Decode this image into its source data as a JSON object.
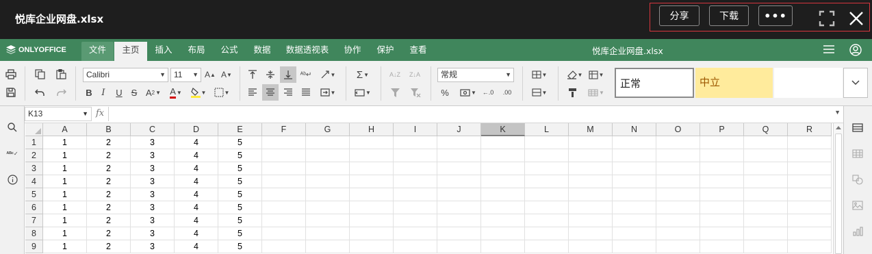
{
  "header": {
    "title": "悦库企业网盘.xlsx",
    "share_label": "分享",
    "download_label": "下载",
    "more_label": "•••"
  },
  "menubar": {
    "logo_text": "ONLYOFFICE",
    "tabs": [
      "文件",
      "主页",
      "插入",
      "布局",
      "公式",
      "数据",
      "数据透视表",
      "协作",
      "保护",
      "查看"
    ],
    "active_tab": "主页",
    "file_title": "悦库企业网盘.xlsx"
  },
  "toolbar": {
    "font_name": "Calibri",
    "font_size": "11",
    "number_format": "常规",
    "cell_styles": [
      "正常",
      "中立",
      ""
    ]
  },
  "formula_bar": {
    "name_box": "K13",
    "fx_label": "fx",
    "formula": ""
  },
  "sheet": {
    "columns": [
      "A",
      "B",
      "C",
      "D",
      "E",
      "F",
      "G",
      "H",
      "I",
      "J",
      "K",
      "L",
      "M",
      "N",
      "O",
      "P",
      "Q",
      "R"
    ],
    "active_column": "K",
    "rows": [
      {
        "num": "1",
        "cells": [
          "1",
          "2",
          "3",
          "4",
          "5"
        ]
      },
      {
        "num": "2",
        "cells": [
          "1",
          "2",
          "3",
          "4",
          "5"
        ]
      },
      {
        "num": "3",
        "cells": [
          "1",
          "2",
          "3",
          "4",
          "5"
        ]
      },
      {
        "num": "4",
        "cells": [
          "1",
          "2",
          "3",
          "4",
          "5"
        ]
      },
      {
        "num": "5",
        "cells": [
          "1",
          "2",
          "3",
          "4",
          "5"
        ]
      },
      {
        "num": "6",
        "cells": [
          "1",
          "2",
          "3",
          "4",
          "5"
        ]
      },
      {
        "num": "7",
        "cells": [
          "1",
          "2",
          "3",
          "4",
          "5"
        ]
      },
      {
        "num": "8",
        "cells": [
          "1",
          "2",
          "3",
          "4",
          "5"
        ]
      },
      {
        "num": "9",
        "cells": [
          "1",
          "2",
          "3",
          "4",
          "5"
        ]
      }
    ]
  },
  "colors": {
    "topbar_bg": "#1e1e1e",
    "brand_green": "#40865c",
    "highlight_border": "#d9363e",
    "neutral_style_bg": "#ffeb9c"
  }
}
